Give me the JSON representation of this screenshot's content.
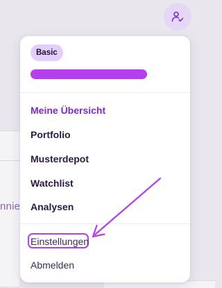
{
  "background": {
    "partial_text": "nnie"
  },
  "header": {
    "account_icon": "user-check-icon"
  },
  "menu": {
    "plan_badge": "Basic",
    "username_bar_color": "#b53ff0",
    "nav_items": [
      {
        "label": "Meine Übersicht",
        "active": true
      },
      {
        "label": "Portfolio",
        "active": false
      },
      {
        "label": "Musterdepot",
        "active": false
      },
      {
        "label": "Watchlist",
        "active": false
      },
      {
        "label": "Analysen",
        "active": false
      }
    ],
    "secondary_items": [
      {
        "label": "Einstellungen",
        "highlighted": true
      },
      {
        "label": "Abmelden",
        "highlighted": false
      }
    ]
  },
  "annotation": {
    "color": "#b53ff0"
  },
  "colors": {
    "accent": "#7b2bd0",
    "badge_bg": "#e3cdfc",
    "avatar_bg": "#e5d8f6"
  }
}
